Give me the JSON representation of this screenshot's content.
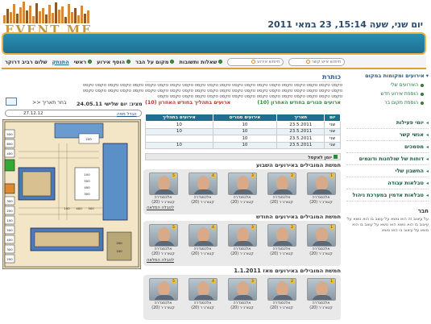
{
  "header": {
    "brand": "EVENT ME",
    "date": "יום שני, שעה 15:14, 23 במאי 2011"
  },
  "nav": {
    "items": [
      {
        "label": "שלום רביב דרוקר"
      },
      {
        "label": "התנתק"
      },
      {
        "label": "ראשי"
      },
      {
        "label": "הוסף אירוע"
      },
      {
        "label": "מקום על הבר"
      },
      {
        "label": "שאלות ותשובות"
      }
    ],
    "search1_placeholder": "חיפוש אירוע",
    "search2_placeholder": "חיפוש איש קשר"
  },
  "sidebar": {
    "heading": "אירועים ומקומות במקום",
    "links": [
      "האירועים שלי",
      "הוספת אירוע חדש",
      "הוספת מקום בר"
    ],
    "menu": [
      "יומי פעילות",
      "אנשי קשר",
      "מסמכים",
      "דוחות של שולחנות ודוגמים",
      "החשבון שלי",
      "טבלאות עבודה",
      "טבלאות אדמין במערכת ניהול"
    ],
    "friends_heading": "חבר",
    "friends_text": "על עיצוב זה הוא נושא על עוצב בו הוא נושא על עיצוב בו הוא נושא הוא נושא על עוצב בו הוא נושא על עיצוב בו הוא נושא"
  },
  "content": {
    "heading": "כותרת",
    "text": "טקסט טקסט טקסט טקסט טקסט טקסט טקסט טקסט טקסט טקסט טקסט טקסט טקסט טקסט טקסט טקסט טקסט טקסט טקסט טקסט טקסט טקסט טקסט טקסט טקסט טקסט טקסט טקסט טקסט טקסט טקסט טקסט טקסט טקסט טקסט טקסט טקסט טקסט טקסט טקסט טקסט טקסט טקסט טקסט טקסט טקסט טקסט טקסט טקסט טקסט טקסט טקסט טקסט טקסט טקסט טקסט טקסט"
  },
  "events": {
    "tab1": "ארועים פגורים בחודש האחרון (10)",
    "tab2": "ארועים בתהליך בחודש האחרון (10)",
    "columns": [
      "יום",
      "תאריך",
      "אירועים סגורים",
      "אירועים בתהליך"
    ],
    "rows": [
      [
        "שני",
        "23.5.2011",
        "10",
        "10"
      ],
      [
        "שני",
        "23.5.2011",
        "10",
        "10"
      ],
      [
        "שני",
        "23.5.2011",
        "10",
        ""
      ],
      [
        "שני",
        "23.5.2011",
        "10",
        "10"
      ]
    ],
    "footer": "יומן לאקסל"
  },
  "leaders": {
    "section1": "חמשת המובילים באירועים השבוע",
    "section2": "חמשת המובילים באירועים החודש",
    "section3": "חמשת המובילים באירועים מאז 1.1.2011",
    "person_name": "אלכסנדרה",
    "person_sub": "קטורנ׳ר (20)",
    "more": "לטבלה המלאה"
  },
  "left_panel": {
    "date_label": "מציג: יום שלישי 24.05.11",
    "change_date": "בחר תאריך <<",
    "date_input": "27.12.12",
    "map_link": "הגדל מפה",
    "map_numbers": [
      "500",
      "600",
      "400",
      "300",
      "200",
      "100",
      "500",
      "400",
      "300",
      "200",
      "100",
      "500",
      "400",
      "300",
      "200",
      "100",
      "400",
      "300",
      "200",
      "100"
    ]
  }
}
